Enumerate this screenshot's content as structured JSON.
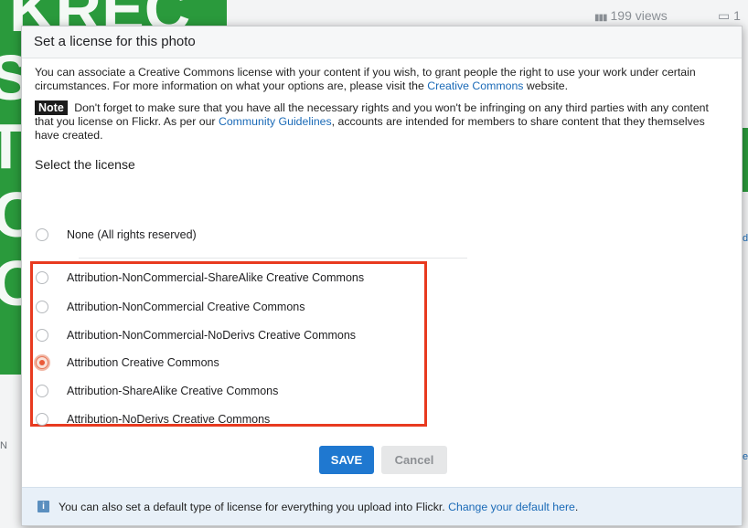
{
  "background": {
    "views": "199 views",
    "comments": "1",
    "letters": [
      "N",
      "d",
      "e"
    ]
  },
  "dialog": {
    "title": "Set a license for this photo",
    "intro_text": "You can associate a Creative Commons license with your content if you wish, to grant people the right to use your work under certain circumstances. For more information on what your options are, please visit the ",
    "intro_link": "Creative Commons",
    "intro_suffix": " website.",
    "note_tag": "Note",
    "note_text": " Don't forget to make sure that you have all the necessary rights and you won't be infringing on any third parties with any content that you license on Flickr. As per our ",
    "note_link": "Community Guidelines",
    "note_suffix": ", accounts are intended for members to share content that they themselves have created.",
    "select_title": "Select the license",
    "options": [
      {
        "label": "None (All rights reserved)",
        "checked": false
      },
      {
        "label": "Attribution-NonCommercial-ShareAlike Creative Commons",
        "checked": false
      },
      {
        "label": "Attribution-NonCommercial Creative Commons",
        "checked": false
      },
      {
        "label": "Attribution-NonCommercial-NoDerivs Creative Commons",
        "checked": false
      },
      {
        "label": "Attribution Creative Commons",
        "checked": true
      },
      {
        "label": "Attribution-ShareAlike Creative Commons",
        "checked": false
      },
      {
        "label": "Attribution-NoDerivs Creative Commons",
        "checked": false
      }
    ],
    "save_label": "SAVE",
    "cancel_label": "Cancel",
    "footer_text": "You can also set a default type of license for everything you upload into Flickr. ",
    "footer_link": "Change your default here",
    "footer_suffix": ".",
    "footer_icon": "info-icon"
  },
  "colors": {
    "accent": "#1f78d0",
    "highlight": "#e83a1f",
    "radio_selected": "#ea5b39",
    "link": "#1a6ab7",
    "bg_green": "#2a9a3c"
  }
}
